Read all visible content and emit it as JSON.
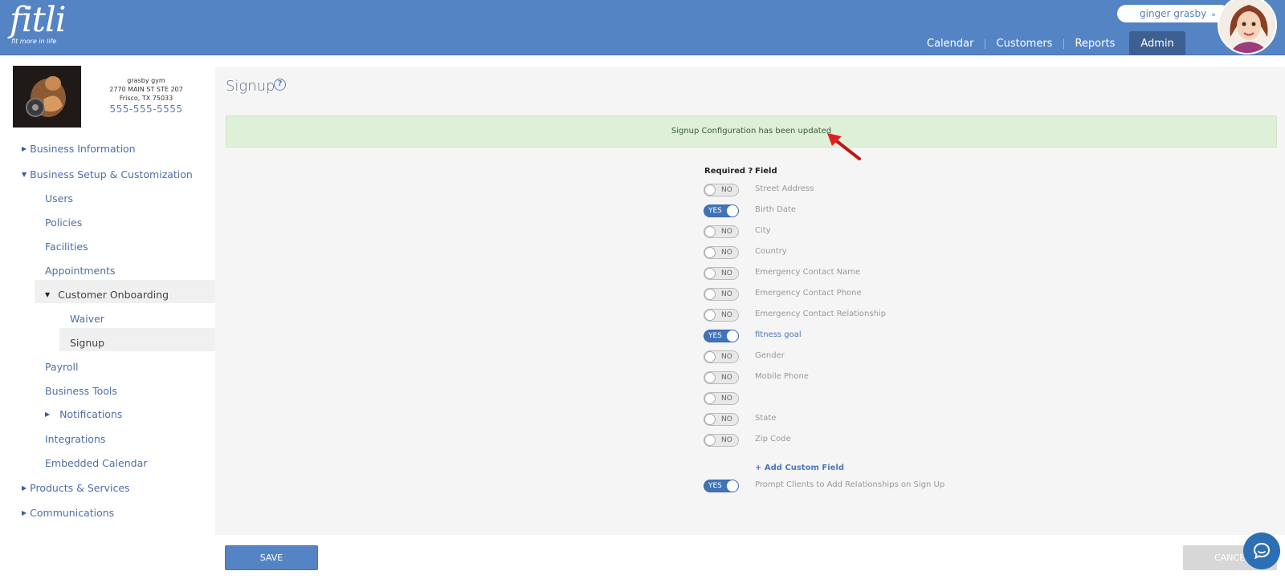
{
  "app": {
    "logo": "fitli",
    "tagline": "fit more in life"
  },
  "user": {
    "name": "ginger grasby",
    "chevron": "»"
  },
  "nav": {
    "items": [
      "Calendar",
      "Customers",
      "Reports",
      "Admin"
    ],
    "active": "Admin"
  },
  "business": {
    "name": "grasby gym",
    "address1": "2770 MAIN ST STE 207",
    "address2": "Frisco, TX 75033",
    "phone": "555-555-5555"
  },
  "sidebar": {
    "business_information": "Business Information",
    "business_setup": "Business Setup & Customization",
    "users": "Users",
    "policies": "Policies",
    "facilities": "Facilities",
    "appointments": "Appointments",
    "customer_onboarding": "Customer Onboarding",
    "waiver": "Waiver",
    "signup": "Signup",
    "payroll": "Payroll",
    "business_tools": "Business Tools",
    "notifications": "Notifications",
    "integrations": "Integrations",
    "embedded_calendar": "Embedded Calendar",
    "products_services": "Products & Services",
    "communications": "Communications"
  },
  "page": {
    "title": "Signup",
    "help": "?"
  },
  "alert": {
    "message": "Signup Configuration has been updated"
  },
  "table": {
    "col_required": "Required ?",
    "col_field": "Field",
    "rows": [
      {
        "state": "NO",
        "field": "Street Address"
      },
      {
        "state": "YES",
        "field": "Birth Date"
      },
      {
        "state": "NO",
        "field": "City"
      },
      {
        "state": "NO",
        "field": "Country"
      },
      {
        "state": "NO",
        "field": "Emergency Contact Name"
      },
      {
        "state": "NO",
        "field": "Emergency Contact Phone"
      },
      {
        "state": "NO",
        "field": "Emergency Contact Relationship"
      },
      {
        "state": "YES",
        "field": "fitness goal"
      },
      {
        "state": "NO",
        "field": "Gender"
      },
      {
        "state": "NO",
        "field": "Mobile Phone"
      },
      {
        "state": "NO",
        "field": ""
      },
      {
        "state": "NO",
        "field": "State"
      },
      {
        "state": "NO",
        "field": "Zip Code"
      }
    ]
  },
  "add_custom_field": "+ Add Custom Field",
  "prompt_relationships": {
    "state": "YES",
    "label": "Prompt Clients to Add Relationships on Sign Up"
  },
  "buttons": {
    "save": "SAVE",
    "cancel": "CANCEL"
  },
  "colors": {
    "header": "#5584c4",
    "accent": "#4173b9",
    "success_bg": "#dff0d8",
    "annotation_arrow": "#e02020"
  },
  "icons": {
    "help": "help-circle-icon",
    "chat": "chat-bubble-icon",
    "alert_pointer": "red-arrow-icon"
  }
}
